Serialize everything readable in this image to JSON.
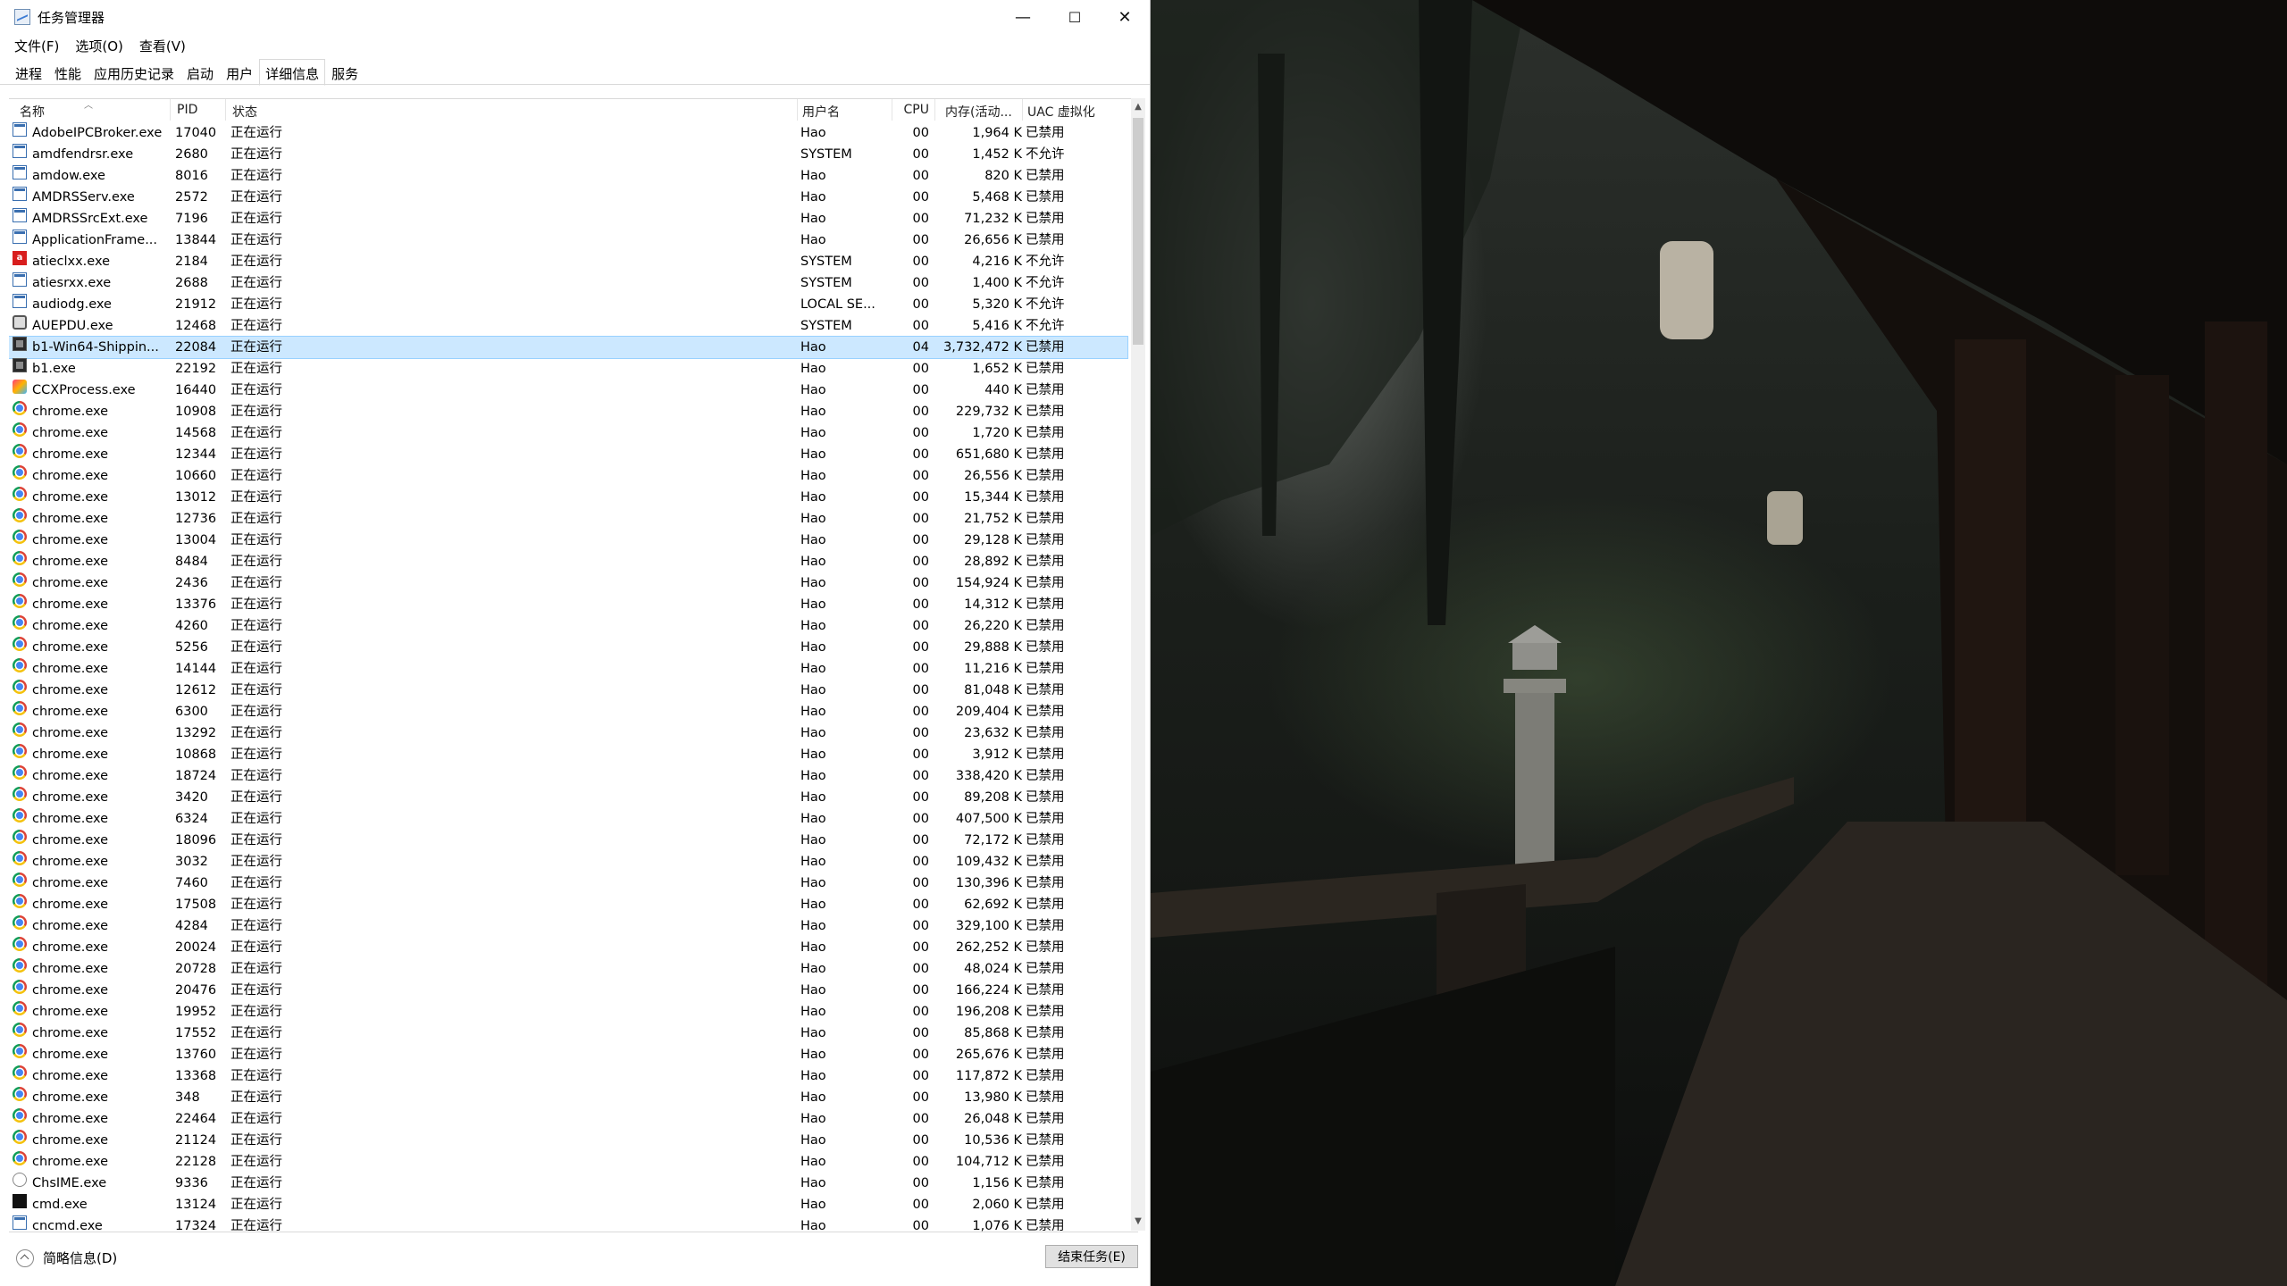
{
  "window": {
    "title": "任务管理器",
    "minimize": "—",
    "maximize": "☐",
    "close": "✕"
  },
  "menu": [
    "文件(F)",
    "选项(O)",
    "查看(V)"
  ],
  "tabs": [
    "进程",
    "性能",
    "应用历史记录",
    "启动",
    "用户",
    "详细信息",
    "服务"
  ],
  "active_tab": 5,
  "columns": {
    "name": "名称",
    "pid": "PID",
    "status": "状态",
    "user": "用户名",
    "cpu": "CPU",
    "mem": "内存(活动...",
    "uac": "UAC 虚拟化"
  },
  "selected_row": 10,
  "processes": [
    {
      "name": "AdobeIPCBroker.exe",
      "pid": "17040",
      "status": "正在运行",
      "user": "Hao",
      "cpu": "00",
      "mem": "1,964 K",
      "uac": "已禁用",
      "icon": "window"
    },
    {
      "name": "amdfendrsr.exe",
      "pid": "2680",
      "status": "正在运行",
      "user": "SYSTEM",
      "cpu": "00",
      "mem": "1,452 K",
      "uac": "不允许",
      "icon": "window"
    },
    {
      "name": "amdow.exe",
      "pid": "8016",
      "status": "正在运行",
      "user": "Hao",
      "cpu": "00",
      "mem": "820 K",
      "uac": "已禁用",
      "icon": "window"
    },
    {
      "name": "AMDRSServ.exe",
      "pid": "2572",
      "status": "正在运行",
      "user": "Hao",
      "cpu": "00",
      "mem": "5,468 K",
      "uac": "已禁用",
      "icon": "window"
    },
    {
      "name": "AMDRSSrcExt.exe",
      "pid": "7196",
      "status": "正在运行",
      "user": "Hao",
      "cpu": "00",
      "mem": "71,232 K",
      "uac": "已禁用",
      "icon": "window"
    },
    {
      "name": "ApplicationFrame...",
      "pid": "13844",
      "status": "正在运行",
      "user": "Hao",
      "cpu": "00",
      "mem": "26,656 K",
      "uac": "已禁用",
      "icon": "window"
    },
    {
      "name": "atieclxx.exe",
      "pid": "2184",
      "status": "正在运行",
      "user": "SYSTEM",
      "cpu": "00",
      "mem": "4,216 K",
      "uac": "不允许",
      "icon": "amd"
    },
    {
      "name": "atiesrxx.exe",
      "pid": "2688",
      "status": "正在运行",
      "user": "SYSTEM",
      "cpu": "00",
      "mem": "1,400 K",
      "uac": "不允许",
      "icon": "window"
    },
    {
      "name": "audiodg.exe",
      "pid": "21912",
      "status": "正在运行",
      "user": "LOCAL SE...",
      "cpu": "00",
      "mem": "5,320 K",
      "uac": "不允许",
      "icon": "window"
    },
    {
      "name": "AUEPDU.exe",
      "pid": "12468",
      "status": "正在运行",
      "user": "SYSTEM",
      "cpu": "00",
      "mem": "5,416 K",
      "uac": "不允许",
      "icon": "gear"
    },
    {
      "name": "b1-Win64-Shippin...",
      "pid": "22084",
      "status": "正在运行",
      "user": "Hao",
      "cpu": "04",
      "mem": "3,732,472 K",
      "uac": "已禁用",
      "icon": "game"
    },
    {
      "name": "b1.exe",
      "pid": "22192",
      "status": "正在运行",
      "user": "Hao",
      "cpu": "00",
      "mem": "1,652 K",
      "uac": "已禁用",
      "icon": "game"
    },
    {
      "name": "CCXProcess.exe",
      "pid": "16440",
      "status": "正在运行",
      "user": "Hao",
      "cpu": "00",
      "mem": "440 K",
      "uac": "已禁用",
      "icon": "cc"
    },
    {
      "name": "chrome.exe",
      "pid": "10908",
      "status": "正在运行",
      "user": "Hao",
      "cpu": "00",
      "mem": "229,732 K",
      "uac": "已禁用",
      "icon": "chrome"
    },
    {
      "name": "chrome.exe",
      "pid": "14568",
      "status": "正在运行",
      "user": "Hao",
      "cpu": "00",
      "mem": "1,720 K",
      "uac": "已禁用",
      "icon": "chrome"
    },
    {
      "name": "chrome.exe",
      "pid": "12344",
      "status": "正在运行",
      "user": "Hao",
      "cpu": "00",
      "mem": "651,680 K",
      "uac": "已禁用",
      "icon": "chrome"
    },
    {
      "name": "chrome.exe",
      "pid": "10660",
      "status": "正在运行",
      "user": "Hao",
      "cpu": "00",
      "mem": "26,556 K",
      "uac": "已禁用",
      "icon": "chrome"
    },
    {
      "name": "chrome.exe",
      "pid": "13012",
      "status": "正在运行",
      "user": "Hao",
      "cpu": "00",
      "mem": "15,344 K",
      "uac": "已禁用",
      "icon": "chrome"
    },
    {
      "name": "chrome.exe",
      "pid": "12736",
      "status": "正在运行",
      "user": "Hao",
      "cpu": "00",
      "mem": "21,752 K",
      "uac": "已禁用",
      "icon": "chrome"
    },
    {
      "name": "chrome.exe",
      "pid": "13004",
      "status": "正在运行",
      "user": "Hao",
      "cpu": "00",
      "mem": "29,128 K",
      "uac": "已禁用",
      "icon": "chrome"
    },
    {
      "name": "chrome.exe",
      "pid": "8484",
      "status": "正在运行",
      "user": "Hao",
      "cpu": "00",
      "mem": "28,892 K",
      "uac": "已禁用",
      "icon": "chrome"
    },
    {
      "name": "chrome.exe",
      "pid": "2436",
      "status": "正在运行",
      "user": "Hao",
      "cpu": "00",
      "mem": "154,924 K",
      "uac": "已禁用",
      "icon": "chrome"
    },
    {
      "name": "chrome.exe",
      "pid": "13376",
      "status": "正在运行",
      "user": "Hao",
      "cpu": "00",
      "mem": "14,312 K",
      "uac": "已禁用",
      "icon": "chrome"
    },
    {
      "name": "chrome.exe",
      "pid": "4260",
      "status": "正在运行",
      "user": "Hao",
      "cpu": "00",
      "mem": "26,220 K",
      "uac": "已禁用",
      "icon": "chrome"
    },
    {
      "name": "chrome.exe",
      "pid": "5256",
      "status": "正在运行",
      "user": "Hao",
      "cpu": "00",
      "mem": "29,888 K",
      "uac": "已禁用",
      "icon": "chrome"
    },
    {
      "name": "chrome.exe",
      "pid": "14144",
      "status": "正在运行",
      "user": "Hao",
      "cpu": "00",
      "mem": "11,216 K",
      "uac": "已禁用",
      "icon": "chrome"
    },
    {
      "name": "chrome.exe",
      "pid": "12612",
      "status": "正在运行",
      "user": "Hao",
      "cpu": "00",
      "mem": "81,048 K",
      "uac": "已禁用",
      "icon": "chrome"
    },
    {
      "name": "chrome.exe",
      "pid": "6300",
      "status": "正在运行",
      "user": "Hao",
      "cpu": "00",
      "mem": "209,404 K",
      "uac": "已禁用",
      "icon": "chrome"
    },
    {
      "name": "chrome.exe",
      "pid": "13292",
      "status": "正在运行",
      "user": "Hao",
      "cpu": "00",
      "mem": "23,632 K",
      "uac": "已禁用",
      "icon": "chrome"
    },
    {
      "name": "chrome.exe",
      "pid": "10868",
      "status": "正在运行",
      "user": "Hao",
      "cpu": "00",
      "mem": "3,912 K",
      "uac": "已禁用",
      "icon": "chrome"
    },
    {
      "name": "chrome.exe",
      "pid": "18724",
      "status": "正在运行",
      "user": "Hao",
      "cpu": "00",
      "mem": "338,420 K",
      "uac": "已禁用",
      "icon": "chrome"
    },
    {
      "name": "chrome.exe",
      "pid": "3420",
      "status": "正在运行",
      "user": "Hao",
      "cpu": "00",
      "mem": "89,208 K",
      "uac": "已禁用",
      "icon": "chrome"
    },
    {
      "name": "chrome.exe",
      "pid": "6324",
      "status": "正在运行",
      "user": "Hao",
      "cpu": "00",
      "mem": "407,500 K",
      "uac": "已禁用",
      "icon": "chrome"
    },
    {
      "name": "chrome.exe",
      "pid": "18096",
      "status": "正在运行",
      "user": "Hao",
      "cpu": "00",
      "mem": "72,172 K",
      "uac": "已禁用",
      "icon": "chrome"
    },
    {
      "name": "chrome.exe",
      "pid": "3032",
      "status": "正在运行",
      "user": "Hao",
      "cpu": "00",
      "mem": "109,432 K",
      "uac": "已禁用",
      "icon": "chrome"
    },
    {
      "name": "chrome.exe",
      "pid": "7460",
      "status": "正在运行",
      "user": "Hao",
      "cpu": "00",
      "mem": "130,396 K",
      "uac": "已禁用",
      "icon": "chrome"
    },
    {
      "name": "chrome.exe",
      "pid": "17508",
      "status": "正在运行",
      "user": "Hao",
      "cpu": "00",
      "mem": "62,692 K",
      "uac": "已禁用",
      "icon": "chrome"
    },
    {
      "name": "chrome.exe",
      "pid": "4284",
      "status": "正在运行",
      "user": "Hao",
      "cpu": "00",
      "mem": "329,100 K",
      "uac": "已禁用",
      "icon": "chrome"
    },
    {
      "name": "chrome.exe",
      "pid": "20024",
      "status": "正在运行",
      "user": "Hao",
      "cpu": "00",
      "mem": "262,252 K",
      "uac": "已禁用",
      "icon": "chrome"
    },
    {
      "name": "chrome.exe",
      "pid": "20728",
      "status": "正在运行",
      "user": "Hao",
      "cpu": "00",
      "mem": "48,024 K",
      "uac": "已禁用",
      "icon": "chrome"
    },
    {
      "name": "chrome.exe",
      "pid": "20476",
      "status": "正在运行",
      "user": "Hao",
      "cpu": "00",
      "mem": "166,224 K",
      "uac": "已禁用",
      "icon": "chrome"
    },
    {
      "name": "chrome.exe",
      "pid": "19952",
      "status": "正在运行",
      "user": "Hao",
      "cpu": "00",
      "mem": "196,208 K",
      "uac": "已禁用",
      "icon": "chrome"
    },
    {
      "name": "chrome.exe",
      "pid": "17552",
      "status": "正在运行",
      "user": "Hao",
      "cpu": "00",
      "mem": "85,868 K",
      "uac": "已禁用",
      "icon": "chrome"
    },
    {
      "name": "chrome.exe",
      "pid": "13760",
      "status": "正在运行",
      "user": "Hao",
      "cpu": "00",
      "mem": "265,676 K",
      "uac": "已禁用",
      "icon": "chrome"
    },
    {
      "name": "chrome.exe",
      "pid": "13368",
      "status": "正在运行",
      "user": "Hao",
      "cpu": "00",
      "mem": "117,872 K",
      "uac": "已禁用",
      "icon": "chrome"
    },
    {
      "name": "chrome.exe",
      "pid": "348",
      "status": "正在运行",
      "user": "Hao",
      "cpu": "00",
      "mem": "13,980 K",
      "uac": "已禁用",
      "icon": "chrome"
    },
    {
      "name": "chrome.exe",
      "pid": "22464",
      "status": "正在运行",
      "user": "Hao",
      "cpu": "00",
      "mem": "26,048 K",
      "uac": "已禁用",
      "icon": "chrome"
    },
    {
      "name": "chrome.exe",
      "pid": "21124",
      "status": "正在运行",
      "user": "Hao",
      "cpu": "00",
      "mem": "10,536 K",
      "uac": "已禁用",
      "icon": "chrome"
    },
    {
      "name": "chrome.exe",
      "pid": "22128",
      "status": "正在运行",
      "user": "Hao",
      "cpu": "00",
      "mem": "104,712 K",
      "uac": "已禁用",
      "icon": "chrome"
    },
    {
      "name": "ChsIME.exe",
      "pid": "9336",
      "status": "正在运行",
      "user": "Hao",
      "cpu": "00",
      "mem": "1,156 K",
      "uac": "已禁用",
      "icon": "ime"
    },
    {
      "name": "cmd.exe",
      "pid": "13124",
      "status": "正在运行",
      "user": "Hao",
      "cpu": "00",
      "mem": "2,060 K",
      "uac": "已禁用",
      "icon": "cmd"
    },
    {
      "name": "cncmd.exe",
      "pid": "17324",
      "status": "正在运行",
      "user": "Hao",
      "cpu": "00",
      "mem": "1,076 K",
      "uac": "已禁用",
      "icon": "window"
    }
  ],
  "footer": {
    "fewer_details": "简略信息(D)",
    "end_task": "结束任务(E)"
  }
}
